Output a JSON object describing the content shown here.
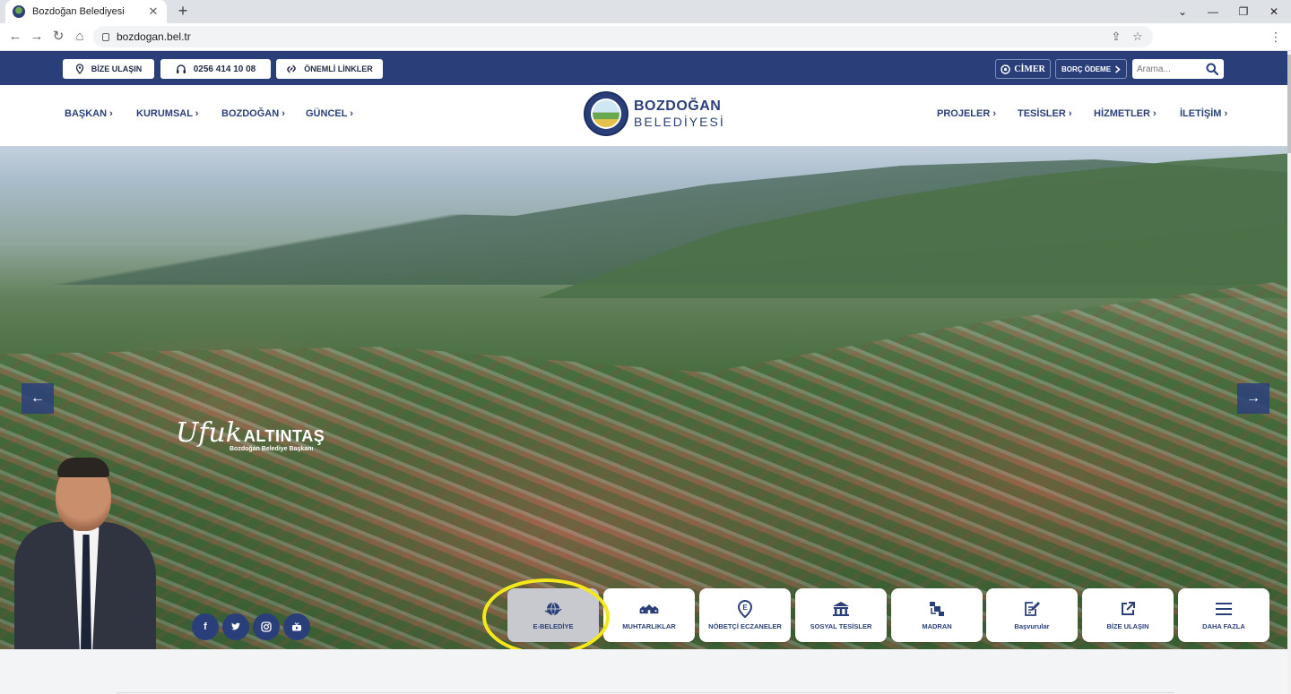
{
  "browser": {
    "tab_title": "Bozdoğan Belediyesi",
    "url": "bozdogan.bel.tr"
  },
  "topbar": {
    "contact_label": "BİZE ULAŞIN",
    "phone": "0256 414 10 08",
    "links_label": "ÖNEMLİ LİNKLER",
    "cimer_label": "CİMER",
    "debt_label": "BORÇ ÖDEME",
    "search_placeholder": "Arama..."
  },
  "nav": {
    "left": [
      "BAŞKAN",
      "KURUMSAL",
      "BOZDOĞAN",
      "GÜNCEL"
    ],
    "right": [
      "PROJELER",
      "TESİSLER",
      "HİZMETLER",
      "İLETİŞİM"
    ],
    "logo_line1": "BOZDOĞAN",
    "logo_line2": "BELEDİYESİ"
  },
  "hero": {
    "prev_label": "←",
    "next_label": "→",
    "mayor_first": "Ufuk",
    "mayor_last": "ALTINTAŞ",
    "mayor_title": "Bozdoğan Belediye Başkanı",
    "social": [
      "f",
      "t",
      "ig",
      "yt"
    ]
  },
  "quick_access": [
    {
      "label": "E-BELEDİYE",
      "icon": "globe-icon",
      "active": true
    },
    {
      "label": "MUHTARLIKLAR",
      "icon": "houses-icon",
      "active": false
    },
    {
      "label": "NÖBETÇİ ECZANELER",
      "icon": "pharmacy-pin-icon",
      "active": false
    },
    {
      "label": "SOSYAL TESİSLER",
      "icon": "building-icon",
      "active": false
    },
    {
      "label": "MADRAN",
      "icon": "madran-icon",
      "active": false
    },
    {
      "label": "Başvurular",
      "icon": "form-edit-icon",
      "active": false
    },
    {
      "label": "BİZE ULAŞIN",
      "icon": "external-link-icon",
      "active": false
    },
    {
      "label": "DAHA FAZLA",
      "icon": "menu-icon",
      "active": false
    }
  ],
  "colors": {
    "brand": "#2a3f7a",
    "highlight": "#f4e81c"
  }
}
